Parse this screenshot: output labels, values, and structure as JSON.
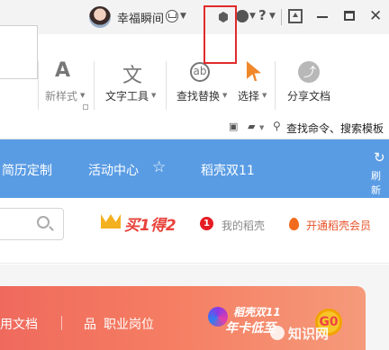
{
  "titlebar": {
    "username": "幸福瞬间",
    "icons": [
      "avatar",
      "crown-badge-icon",
      "hex-icon",
      "skin-icon",
      "help-icon",
      "upload-icon",
      "minimize-icon",
      "maximize-icon",
      "close-icon"
    ],
    "help_label": "?",
    "close_label": "✕"
  },
  "ribbon": {
    "new_style": "新样式",
    "text_tools": "文字工具",
    "find_replace": "查找替换",
    "select": "选择",
    "share_doc": "分享文档",
    "command_search": "查找命令、搜索模板",
    "text_tools_glyph": "文",
    "style_glyph": "A",
    "find_glyph": "ab"
  },
  "nav": {
    "resume": "简历定制",
    "activity": "活动中心",
    "shell_sale": "稻壳双11",
    "refresh": "刷新"
  },
  "promo_row": {
    "buy_one_get_two": "买1得2",
    "alert_count": "1",
    "my_shell": "我的稻壳",
    "open_vip": "开通稻壳会员"
  },
  "banner": {
    "docs": "用文档",
    "jobs": "职业岗位",
    "tag_top": "稻壳双11",
    "tag_bottom": "年卡低至",
    "coin": "G0",
    "watermark": "知识网"
  },
  "colors": {
    "accent_blue": "#5a9ce4",
    "promo_red": "#e8423a",
    "vip_orange": "#e8532a",
    "highlight_red": "#e02b2b"
  }
}
